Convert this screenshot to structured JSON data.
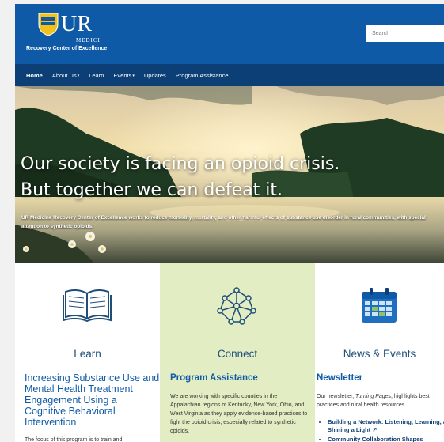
{
  "header": {
    "logo_text": "UR",
    "logo_subtext": "MEDICINE",
    "tagline": "Recovery Center of Excellence",
    "search_placeholder": "Search",
    "brand_color": "#0f5aa6"
  },
  "nav": {
    "items": [
      {
        "label": "Home",
        "active": true,
        "dropdown": false
      },
      {
        "label": "About Us",
        "active": false,
        "dropdown": true
      },
      {
        "label": "Learn",
        "active": false,
        "dropdown": false
      },
      {
        "label": "Events",
        "active": false,
        "dropdown": true
      },
      {
        "label": "Updates",
        "active": false,
        "dropdown": false
      },
      {
        "label": "Program Assistance",
        "active": false,
        "dropdown": false
      }
    ],
    "caret": "▾"
  },
  "hero": {
    "headline_line1": "Our society is facing an opioid crisis.",
    "headline_line2": "But together we can defeat it.",
    "subtext": "UR Medicine Recovery Center of Excellence works to reduce morbidity, mortality, and other harmful effects of substance use disorder in rural communities, with special attention to synthetic opioids."
  },
  "columns": {
    "learn": {
      "icon": "open-book-icon",
      "title": "Learn",
      "subtitle": "Increasing Substance Use and Mental Health Treatment Engagement Using a Cognitive Behavioral Intervention",
      "body": "The focus of this program is to train and"
    },
    "connect": {
      "icon": "network-nodes-icon",
      "title": "Connect",
      "subtitle": "Program Assistance",
      "body": "We are working with specific counties in the Appalachian regions of Kentucky, New York, Ohio, and West Virginia as they apply evidence-based practices to fight the opioid crisis, especially related to synthetic opioids."
    },
    "news": {
      "icon": "calendar-icon",
      "title": "News & Events",
      "subtitle": "Newsletter",
      "body_before": "Our newsletter, ",
      "body_em": "Turning Pages",
      "body_after": ", highlights best practices and rural health resources.",
      "list": [
        "Building a Network: Listening, Learning, and Shining a Light ↗",
        "Community Collaboration Shapes"
      ]
    }
  }
}
